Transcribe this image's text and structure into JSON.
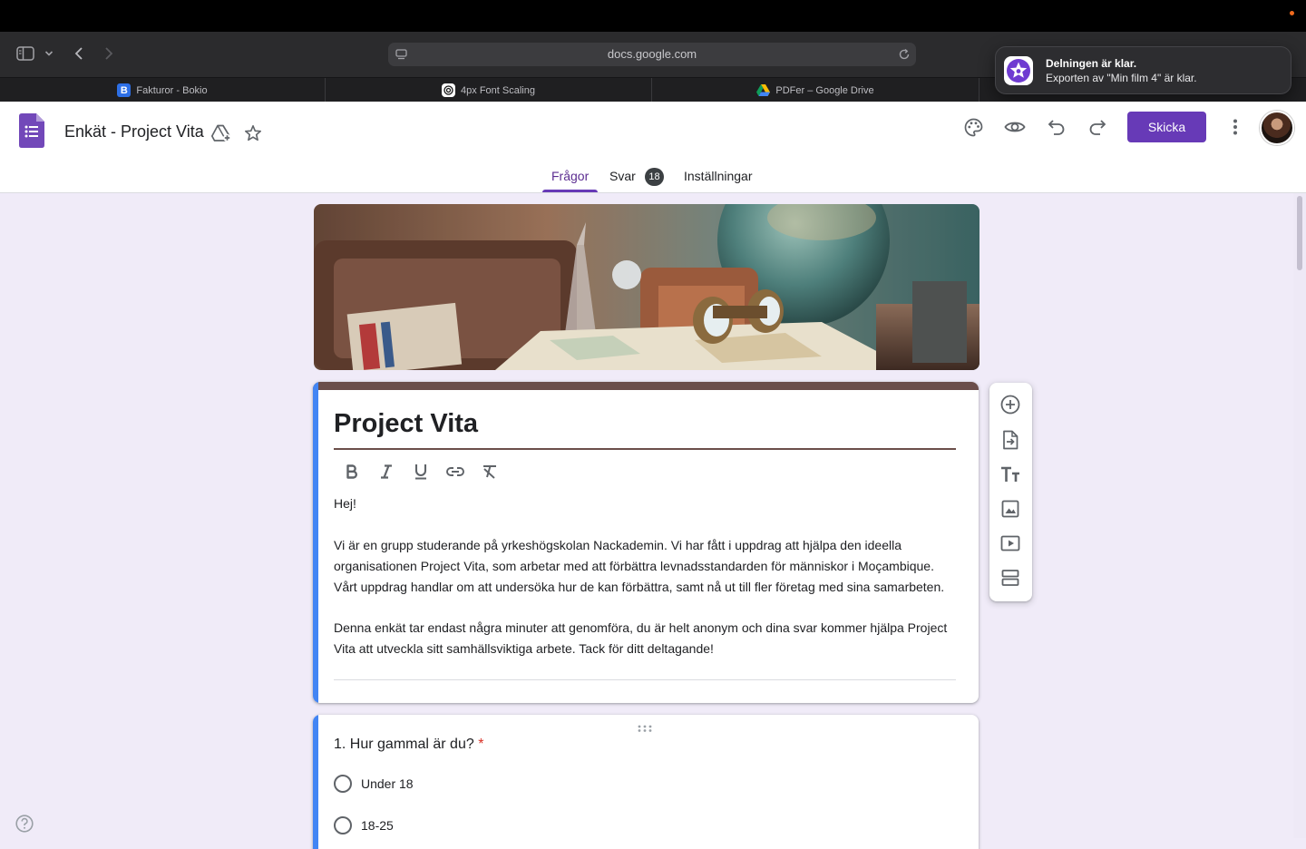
{
  "browser": {
    "url": "docs.google.com",
    "tabs": [
      {
        "label": "Fakturor - Bokio",
        "favicon": "B"
      },
      {
        "label": "4px Font Scaling",
        "favicon": "openai-icon"
      },
      {
        "label": "PDFer – Google Drive",
        "favicon": "drive-icon"
      }
    ]
  },
  "notification": {
    "title": "Delningen är klar.",
    "body": "Exporten av \"Min film 4\" är klar."
  },
  "header": {
    "doc_title": "Enkät - Project Vita",
    "send_label": "Skicka",
    "tabs": [
      {
        "label": "Frågor",
        "active": true
      },
      {
        "label": "Svar",
        "badge": "18"
      },
      {
        "label": "Inställningar"
      }
    ]
  },
  "form": {
    "title": "Project Vita",
    "description": [
      "Hej!",
      "Vi är en grupp studerande på yrkeshögskolan Nackademin. Vi har fått i uppdrag att hjälpa den ideella organisationen Project Vita, som arbetar med att förbättra levnadsstandarden för människor i Moçambique. Vårt uppdrag handlar om att undersöka hur de kan förbättra, samt nå ut till fler företag med sina samarbeten.",
      "Denna enkät tar endast några minuter att genomföra, du är helt anonym och dina svar kommer hjälpa Project Vita att utveckla sitt samhällsviktiga arbete. Tack för ditt deltagande!"
    ],
    "question": {
      "title": "1. Hur gammal är du?",
      "required_mark": "*",
      "options": [
        "Under 18",
        "18-25"
      ]
    }
  },
  "colors": {
    "accent": "#673ab7",
    "active_card": "#4285f4",
    "theme_header": "#6b4e4a"
  }
}
